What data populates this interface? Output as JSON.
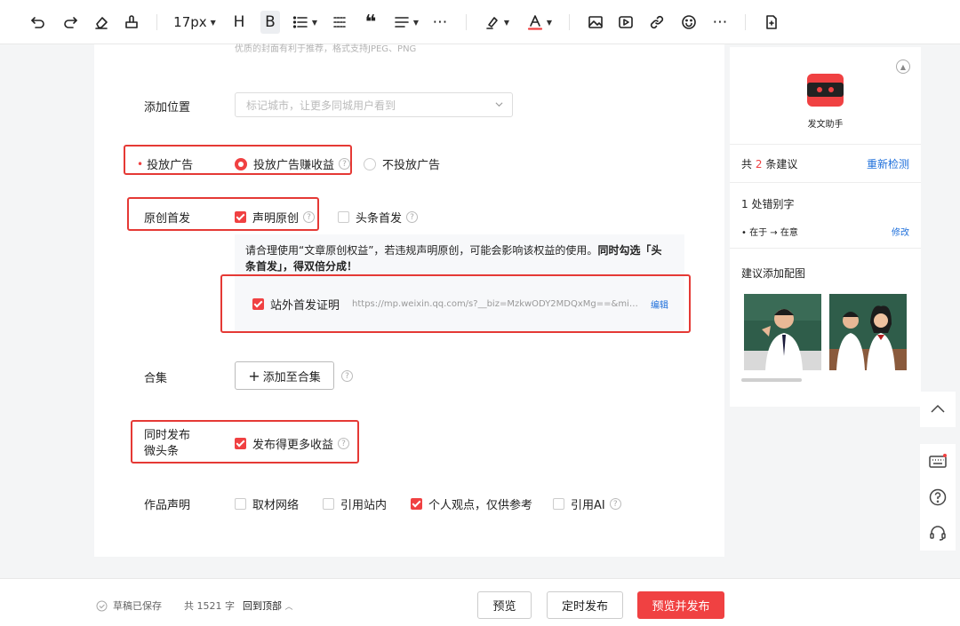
{
  "toolbar": {
    "font_size": "17px",
    "heading": "H",
    "bold": "B",
    "quote": "❝",
    "more": "⋯"
  },
  "form": {
    "cover_hint": "优质的封面有利于推荐，格式支持JPEG、PNG",
    "location_label": "添加位置",
    "location_placeholder": "标记城市，让更多同城用户看到",
    "ads_label": "投放广告",
    "ads_on": "投放广告赚收益",
    "ads_off": "不投放广告",
    "original_label": "原创首发",
    "original_declare": "声明原创",
    "first_publish": "头条首发",
    "notice_normal": "请合理使用“文章原创权益”，若违规声明原创，可能会影响该权益的使用。",
    "notice_bold_1": "同时勾选「头",
    "notice_bold_2": "条首发」，得双倍分成！",
    "offsite_proof": "站外首发证明",
    "offsite_url": "https://mp.weixin.qq.com/s?__biz=MzkwODY2MDQxMg==&mid=...",
    "offsite_edit": "编辑",
    "collection_label": "合集",
    "collection_button": "添加至合集",
    "weitoutiao_label_1": "同时发布",
    "weitoutiao_label_2": "微头条",
    "weitoutiao_option": "发布得更多收益",
    "statement_label": "作品声明",
    "statement_options": [
      "取材网络",
      "引用站内",
      "个人观点，仅供参考",
      "引用AI"
    ]
  },
  "assistant": {
    "name": "发文助手",
    "total_prefix": "共",
    "total_count": "2",
    "total_suffix": "条建议",
    "recheck": "重新检测",
    "typo_title": "1 处错别字",
    "typo_from": "在于",
    "typo_arrow": "→",
    "typo_to": "在意",
    "typo_fix": "修改",
    "image_title": "建议添加配图"
  },
  "footer": {
    "saved": "草稿已保存",
    "word_count": "共 1521 字",
    "back_top": "回到顶部",
    "preview": "预览",
    "schedule": "定时发布",
    "publish": "预览并发布"
  },
  "colors": {
    "accent": "#f04142",
    "link": "#1e6fdb",
    "highlight_box": "#e53935"
  }
}
